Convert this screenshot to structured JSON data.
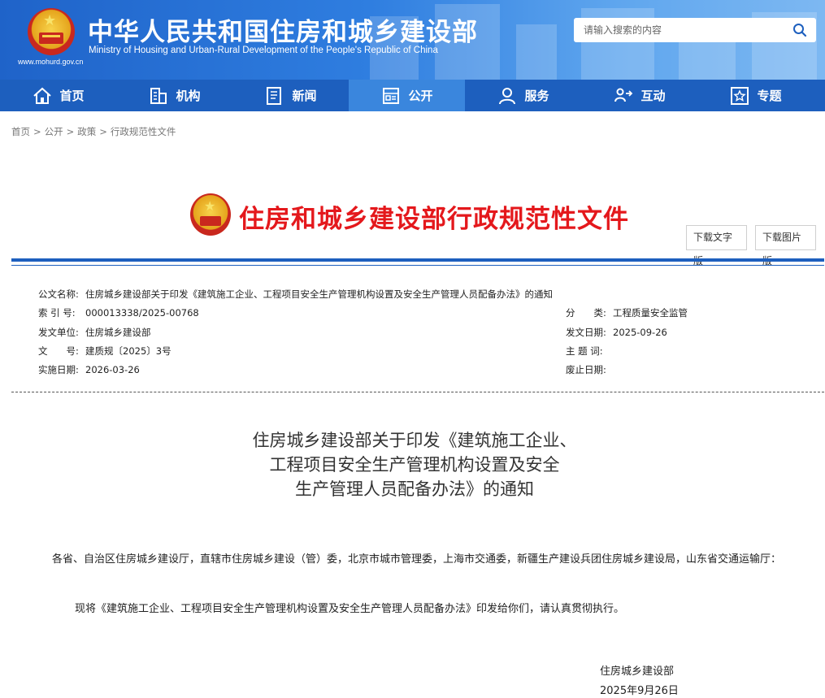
{
  "header": {
    "title": "中华人民共和国住房和城乡建设部",
    "subtitle": "Ministry of Housing and Urban-Rural Development of the People's Republic of China",
    "url": "www.mohurd.gov.cn",
    "search_placeholder": "请输入搜索的内容",
    "brand_color": "#1d5fbe"
  },
  "nav": {
    "items": [
      {
        "label": "首页",
        "icon": "home-icon"
      },
      {
        "label": "机构",
        "icon": "building-icon"
      },
      {
        "label": "新闻",
        "icon": "news-icon"
      },
      {
        "label": "公开",
        "icon": "public-icon",
        "active": true
      },
      {
        "label": "服务",
        "icon": "service-icon"
      },
      {
        "label": "互动",
        "icon": "interaction-icon"
      },
      {
        "label": "专题",
        "icon": "topic-icon"
      }
    ]
  },
  "breadcrumb": [
    "首页",
    "公开",
    "政策",
    "行政规范性文件"
  ],
  "banner": {
    "title": "住房和城乡建设部行政规范性文件",
    "download_text": "下载文字版",
    "download_image": "下载图片版"
  },
  "meta": {
    "doc_name_label": "公文名称:",
    "doc_name": "住房城乡建设部关于印发《建筑施工企业、工程项目安全生产管理机构设置及安全生产管理人员配备办法》的通知",
    "index_label": "索 引 号:",
    "index": "000013338/2025-00768",
    "category_label": "分　　类:",
    "category": "工程质量安全监管",
    "issuer_label": "发文单位:",
    "issuer": "住房城乡建设部",
    "issue_date_label": "发文日期:",
    "issue_date": "2025-09-26",
    "doc_no_label": "文　　号:",
    "doc_no": "建质规〔2025〕3号",
    "subject_label": "主 题 词:",
    "subject": "",
    "effective_label": "实施日期:",
    "effective": "2026-03-26",
    "abolish_label": "废止日期:",
    "abolish": ""
  },
  "document": {
    "title_line1": "住房城乡建设部关于印发《建筑施工企业、",
    "title_line2": "工程项目安全生产管理机构设置及安全",
    "title_line3": "生产管理人员配备办法》的通知",
    "para1": "各省、自治区住房城乡建设厅，直辖市住房城乡建设（管）委，北京市城市管理委，上海市交通委，新疆生产建设兵团住房城乡建设局，山东省交通运输厅：",
    "para2": "现将《建筑施工企业、工程项目安全生产管理机构设置及安全生产管理人员配备办法》印发给你们，请认真贯彻执行。",
    "signature": "住房城乡建设部",
    "date": "2025年9月26日"
  }
}
